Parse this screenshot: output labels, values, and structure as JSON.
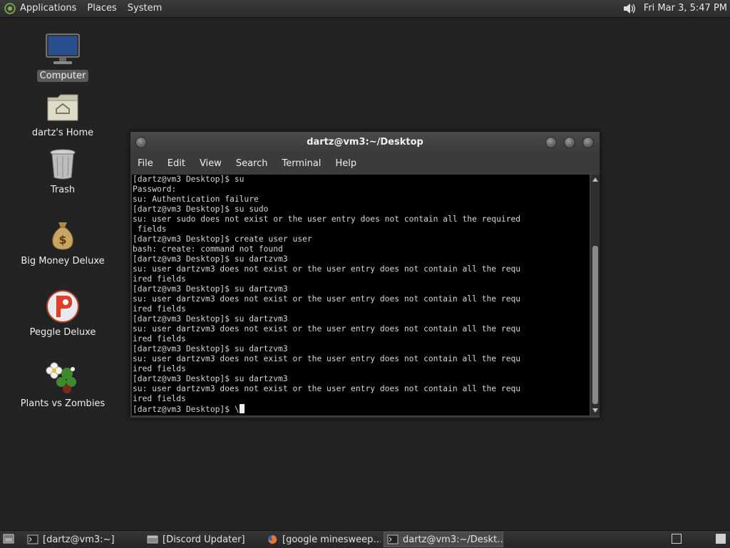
{
  "top_panel": {
    "menus": [
      "Applications",
      "Places",
      "System"
    ],
    "clock": "Fri Mar  3,  5:47 PM",
    "icons": {
      "logo": "gnome-foot-icon",
      "volume": "volume-icon"
    }
  },
  "desktop": {
    "icons": [
      {
        "label": "Computer",
        "icon": "computer-icon",
        "selected": true
      },
      {
        "label": "dartz's Home",
        "icon": "home-folder-icon"
      },
      {
        "label": "Trash",
        "icon": "trash-icon"
      },
      {
        "label": "Big Money Deluxe",
        "icon": "money-bag-icon"
      },
      {
        "label": "Peggle Deluxe",
        "icon": "peggle-icon"
      },
      {
        "label": "Plants vs Zombies",
        "icon": "flower-icon"
      }
    ]
  },
  "terminal": {
    "title": "dartz@vm3:~/Desktop",
    "menu": [
      "File",
      "Edit",
      "View",
      "Search",
      "Terminal",
      "Help"
    ],
    "lines": [
      "[dartz@vm3 Desktop]$ su",
      "Password:",
      "su: Authentication failure",
      "[dartz@vm3 Desktop]$ su sudo",
      "su: user sudo does not exist or the user entry does not contain all the required",
      " fields",
      "[dartz@vm3 Desktop]$ create user user",
      "bash: create: command not found",
      "[dartz@vm3 Desktop]$ su dartzvm3",
      "su: user dartzvm3 does not exist or the user entry does not contain all the requ",
      "ired fields",
      "[dartz@vm3 Desktop]$ su dartzvm3",
      "su: user dartzvm3 does not exist or the user entry does not contain all the requ",
      "ired fields",
      "[dartz@vm3 Desktop]$ su dartzvm3",
      "su: user dartzvm3 does not exist or the user entry does not contain all the requ",
      "ired fields",
      "[dartz@vm3 Desktop]$ su dartzvm3",
      "su: user dartzvm3 does not exist or the user entry does not contain all the requ",
      "ired fields",
      "[dartz@vm3 Desktop]$ su dartzvm3",
      "su: user dartzvm3 does not exist or the user entry does not contain all the requ",
      "ired fields"
    ],
    "prompt": "[dartz@vm3 Desktop]$ \\"
  },
  "taskbar": {
    "tasks": [
      {
        "label": "[dartz@vm3:~]",
        "icon": "terminal-icon",
        "active": false
      },
      {
        "label": "[Discord Updater]",
        "icon": "window-icon",
        "active": false
      },
      {
        "label": "[google minesweep…",
        "icon": "firefox-icon",
        "active": false
      },
      {
        "label": "dartz@vm3:~/Deskt…",
        "icon": "terminal-icon",
        "active": true
      }
    ],
    "workspaces": [
      {
        "active": false
      },
      {
        "active": true
      }
    ]
  },
  "colors": {
    "desktop_bg": "#232323",
    "terminal_bg": "#000000",
    "terminal_fg": "#d6d6d6"
  }
}
